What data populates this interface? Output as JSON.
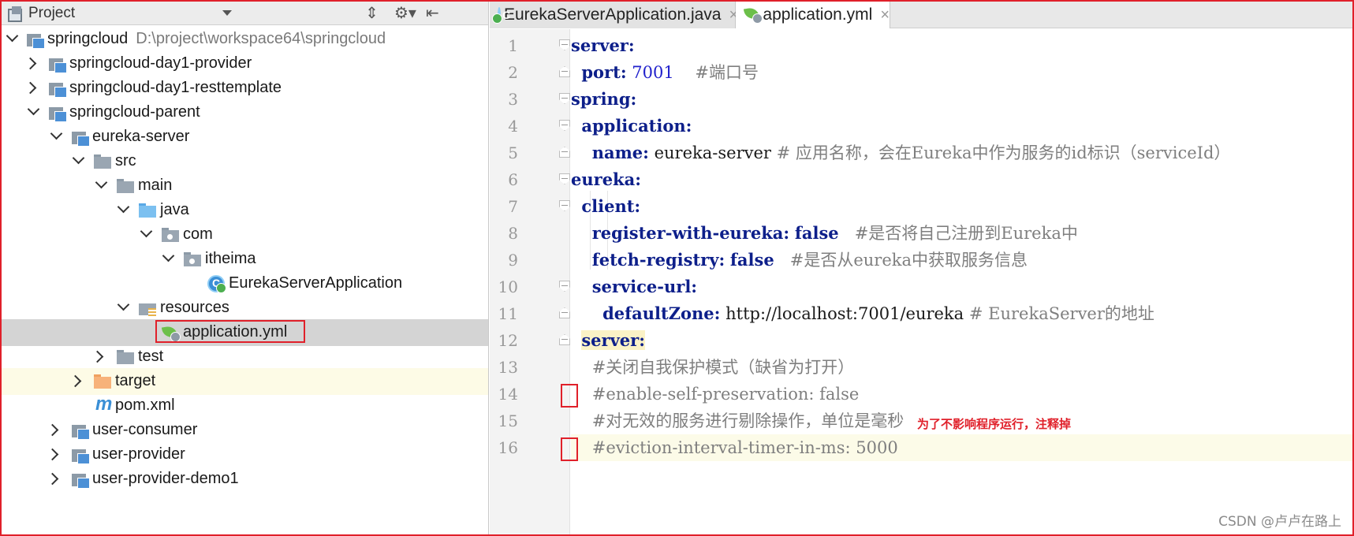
{
  "project_panel": {
    "title": "Project",
    "tree": [
      {
        "label": "springcloud",
        "path": "D:\\project\\workspace64\\springcloud"
      },
      {
        "label": "springcloud-day1-provider"
      },
      {
        "label": "springcloud-day1-resttemplate"
      },
      {
        "label": "springcloud-parent"
      },
      {
        "label": "eureka-server"
      },
      {
        "label": "src"
      },
      {
        "label": "main"
      },
      {
        "label": "java"
      },
      {
        "label": "com"
      },
      {
        "label": "itheima"
      },
      {
        "label": "EurekaServerApplication"
      },
      {
        "label": "resources"
      },
      {
        "label": "application.yml"
      },
      {
        "label": "test"
      },
      {
        "label": "target"
      },
      {
        "label": "pom.xml"
      },
      {
        "label": "user-consumer"
      },
      {
        "label": "user-provider"
      },
      {
        "label": "user-provider-demo1"
      }
    ]
  },
  "editor": {
    "tabs": [
      {
        "label": "EurekaServerApplication.java",
        "close": "×"
      },
      {
        "label": "application.yml",
        "close": "×"
      }
    ],
    "line_numbers": [
      "1",
      "2",
      "3",
      "4",
      "5",
      "6",
      "7",
      "8",
      "9",
      "10",
      "11",
      "12",
      "13",
      "14",
      "15",
      "16"
    ],
    "lines": {
      "l1_key": "server:",
      "l2_key": "port:",
      "l2_val": "7001",
      "l2_comment": "#端口号",
      "l3_key": "spring:",
      "l4_key": "application:",
      "l5_key": "name:",
      "l5_val": "eureka-server",
      "l5_comment": "# 应用名称，会在Eureka中作为服务的id标识（serviceId）",
      "l6_key": "eureka:",
      "l7_key": "client:",
      "l8_key": "register-with-eureka:",
      "l8_val": "false",
      "l8_comment": "#是否将自己注册到Eureka中",
      "l9_key": "fetch-registry:",
      "l9_val": "false",
      "l9_comment": "#是否从eureka中获取服务信息",
      "l10_key": "service-url:",
      "l11_key": "defaultZone:",
      "l11_val": "http://localhost:7001/eureka",
      "l11_comment": "# EurekaServer的地址",
      "l12_key": "server:",
      "l13_comment": "#关闭自我保护模式（缺省为打开）",
      "l14_hash": "#",
      "l14_rest": "enable-self-preservation: false",
      "l15_comment": "#对无效的服务进行剔除操作，单位是毫秒",
      "l16_hash": "#",
      "l16_rest": "eviction-interval-timer-in-ms: 5000"
    },
    "annotation": "为了不影响程序运行，注释掉"
  },
  "watermark": "CSDN @卢卢在路上"
}
